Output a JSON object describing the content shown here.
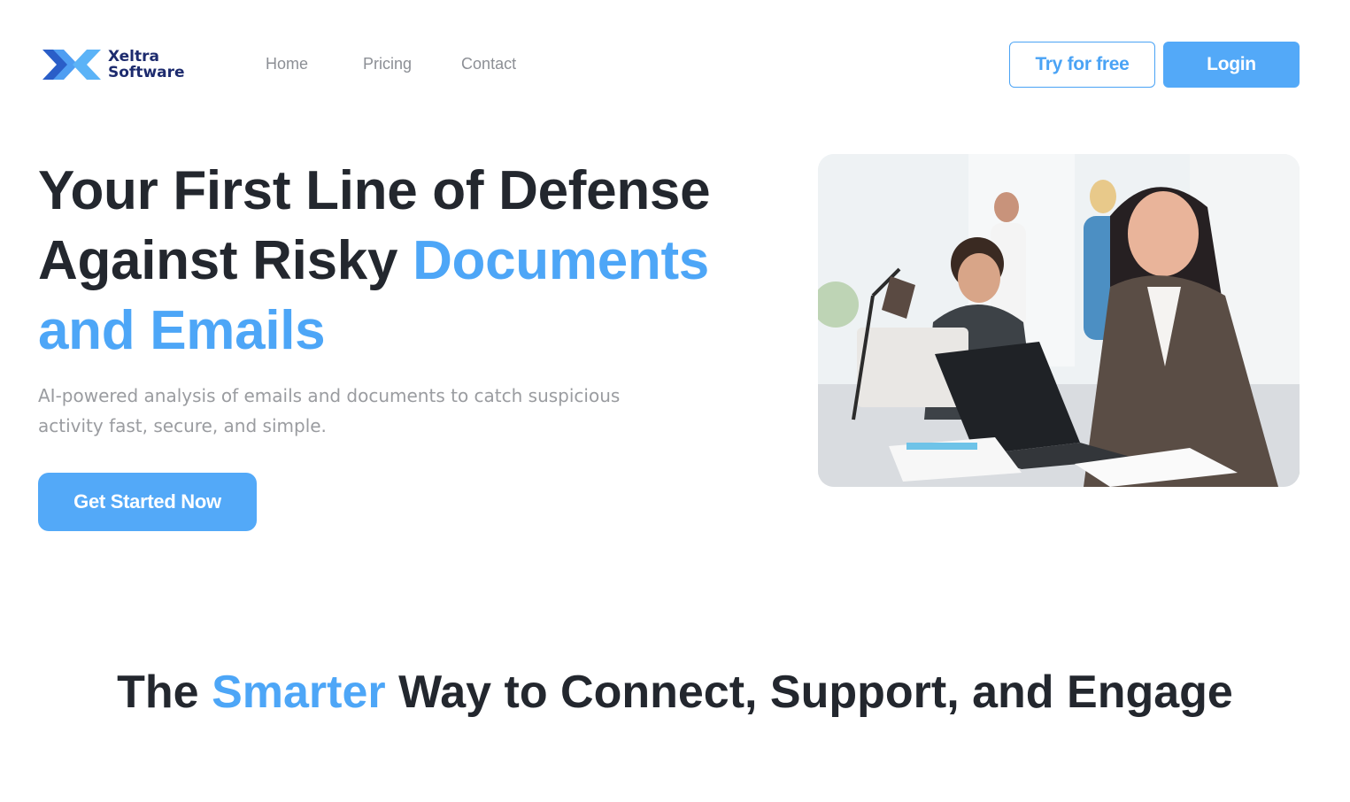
{
  "brand": {
    "line1": "Xeltra",
    "line2": "Software",
    "logo_icon": "x-logo-icon",
    "colors": {
      "logo_dark": "#2a5ec8",
      "logo_light": "#5bb3f7",
      "text": "#1d2b6e"
    }
  },
  "nav": {
    "links": [
      {
        "label": "Home"
      },
      {
        "label": "Pricing"
      },
      {
        "label": "Contact"
      }
    ],
    "try_label": "Try for free",
    "login_label": "Login"
  },
  "hero": {
    "title_part1": "Your First Line of Defense Against Risky ",
    "title_accent": "Documents and Emails",
    "subtitle": "AI-powered analysis of emails and documents to catch suspicious activity fast, secure, and simple.",
    "cta_label": "Get Started Now",
    "image_icon": "office-photo"
  },
  "section2": {
    "title_pre": "The ",
    "title_accent": "Smarter",
    "title_post": " Way to Connect, Support, and Engage"
  },
  "colors": {
    "accent": "#4da6f7",
    "button": "#53a9f8",
    "heading": "#23272e",
    "muted": "#9a9ca0"
  }
}
